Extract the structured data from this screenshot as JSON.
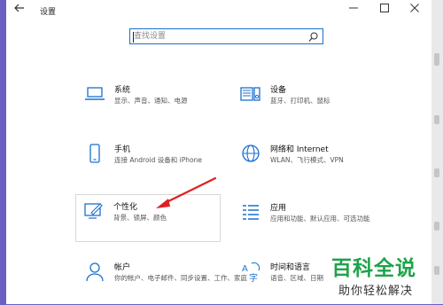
{
  "window": {
    "title": "设置",
    "back_icon": "back-arrow-icon",
    "controls": [
      "minimize-icon",
      "maximize-icon",
      "close-icon"
    ]
  },
  "search": {
    "placeholder": "查找设置",
    "icon": "search-icon"
  },
  "tiles": [
    {
      "title": "系统",
      "desc": "显示、声音、通知、电源",
      "icon": "laptop-icon"
    },
    {
      "title": "设备",
      "desc": "蓝牙、打印机、鼠标",
      "icon": "devices-icon"
    },
    {
      "title": "手机",
      "desc": "连接 Android 设备和 iPhone",
      "icon": "phone-icon"
    },
    {
      "title": "网络和 Internet",
      "desc": "WLAN、飞行模式、VPN",
      "icon": "globe-icon"
    },
    {
      "title": "个性化",
      "desc": "背景、锁屏、颜色",
      "icon": "personalization-icon",
      "highlighted": true
    },
    {
      "title": "应用",
      "desc": "应用和功能、默认应用、可选功能",
      "icon": "apps-icon"
    },
    {
      "title": "帐户",
      "desc": "你的帐户、电子邮件、同步设置、工作、家庭",
      "icon": "account-icon"
    },
    {
      "title": "时间和语言",
      "desc": "语音、区域、日期",
      "icon": "time-language-icon"
    }
  ],
  "annotation": {
    "arrow_color": "#e02020"
  },
  "watermark": {
    "title": "百科全说",
    "subtitle": "助你轻松解决",
    "color": "#1ea34a"
  },
  "colors": {
    "accent": "#1a6fd1",
    "background_strip": "#6b5fc1"
  }
}
